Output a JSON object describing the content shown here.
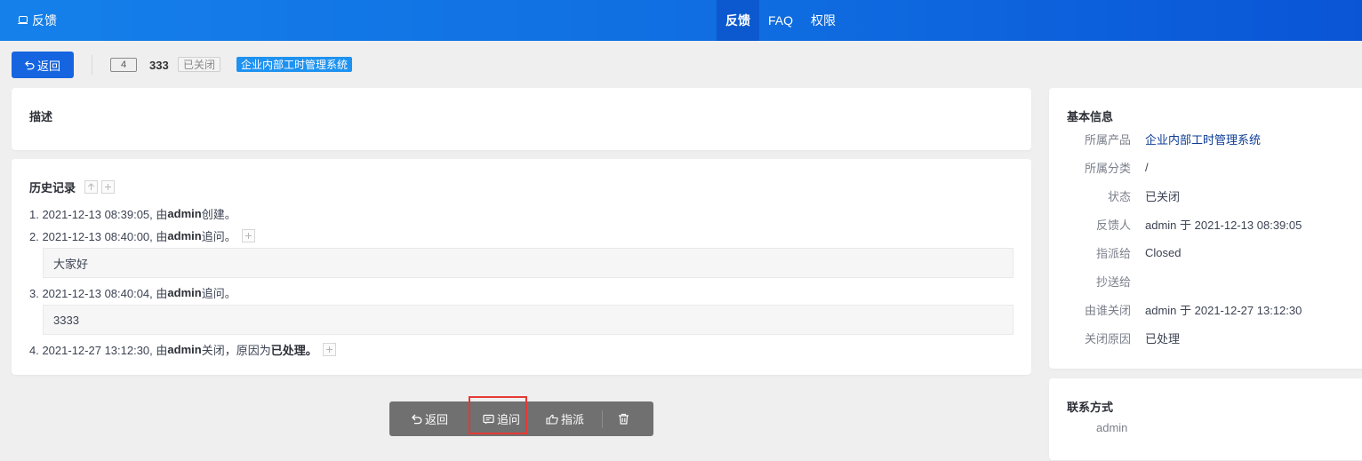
{
  "navbar": {
    "app_name": "反馈",
    "menu": [
      {
        "label": "反馈",
        "active": true
      },
      {
        "label": "FAQ",
        "active": false
      },
      {
        "label": "权限",
        "active": false
      }
    ]
  },
  "toolbar": {
    "back_label": "返回",
    "id": "4",
    "title": "333",
    "status": "已关闭",
    "product": "企业内部工时管理系统"
  },
  "description": {
    "title": "描述"
  },
  "history": {
    "title": "历史记录",
    "entries": [
      {
        "prefix": "1. 2021-12-13 08:39:05, 由 ",
        "user": "admin",
        "suffix": " 创建。"
      },
      {
        "prefix": "2. 2021-12-13 08:40:00, 由 ",
        "user": "admin",
        "suffix": " 追问。",
        "comment": "大家好"
      },
      {
        "prefix": "3. 2021-12-13 08:40:04, 由 ",
        "user": "admin",
        "suffix": " 追问。",
        "comment": "3333"
      },
      {
        "prefix": "4. 2021-12-27 13:12:30, 由 ",
        "user": "admin",
        "suffix": " 关闭，原因为 ",
        "reason": "已处理。"
      }
    ]
  },
  "actions": {
    "back_label": "返回",
    "ask_label": "追问",
    "assign_label": "指派"
  },
  "basic_info": {
    "title": "基本信息",
    "rows": [
      {
        "key": "所属产品",
        "value": "企业内部工时管理系统"
      },
      {
        "key": "所属分类",
        "value": "/"
      },
      {
        "key": "状态",
        "value": "已关闭"
      },
      {
        "key": "反馈人",
        "value": "admin 于 2021-12-13 08:39:05"
      },
      {
        "key": "指派给",
        "value": "Closed"
      },
      {
        "key": "抄送给",
        "value": ""
      },
      {
        "key": "由谁关闭",
        "value": "admin 于 2021-12-27 13:12:30"
      },
      {
        "key": "关闭原因",
        "value": "已处理"
      }
    ]
  },
  "contact": {
    "title": "联系方式",
    "value": "admin"
  },
  "colors": {
    "navbar_blue": "#1580ea",
    "primary_button": "#1665e0",
    "product_tag": "#1e92f0",
    "action_bar": "#707070",
    "highlight": "#e53935"
  }
}
